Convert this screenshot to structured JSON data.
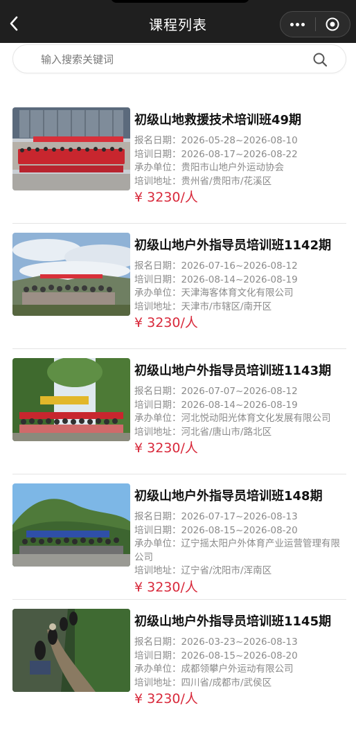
{
  "header": {
    "title": "课程列表",
    "back_icon": "back-icon",
    "more_icon": "more-icon",
    "close_icon": "close-icon"
  },
  "search": {
    "placeholder": "输入搜索关键词",
    "value": "",
    "icon": "search-icon"
  },
  "labels": {
    "signup": "报名日期：",
    "training": "培训日期：",
    "organizer": "承办单位：",
    "address": "培训地址："
  },
  "courses": [
    {
      "name": "初级山地救援技术培训班49期",
      "signup": "2026-05-28~2026-08-10",
      "training": "2026-08-17~2026-08-22",
      "organizer": "贵阳市山地户外运动协会",
      "address": "贵州省/贵阳市/花溪区",
      "price": "¥ 3230/人"
    },
    {
      "name": "初级山地户外指导员培训班1142期",
      "signup": "2026-07-16~2026-08-12",
      "training": "2026-08-14~2026-08-19",
      "organizer": "天津海客体育文化有限公司",
      "address": "天津市/市辖区/南开区",
      "price": "¥ 3230/人"
    },
    {
      "name": "初级山地户外指导员培训班1143期",
      "signup": "2026-07-07~2026-08-12",
      "training": "2026-08-14~2026-08-19",
      "organizer": "河北悦动阳光体育文化发展有限公司",
      "address": "河北省/唐山市/路北区",
      "price": "¥ 3230/人"
    },
    {
      "name": "初级山地户外指导员培训班148期",
      "signup": "2026-07-17~2026-08-13",
      "training": "2026-08-15~2026-08-20",
      "organizer": "辽宁摇太阳户外体育产业运营管理有限公司",
      "address": "辽宁省/沈阳市/浑南区",
      "price": "¥ 3230/人"
    },
    {
      "name": "初级山地户外指导员培训班1145期",
      "signup": "2026-03-23~2026-08-13",
      "training": "2026-08-15~2026-08-20",
      "organizer": "成都领攀户外运动有限公司",
      "address": "四川省/成都市/武侯区",
      "price": "¥ 3230/人"
    }
  ]
}
